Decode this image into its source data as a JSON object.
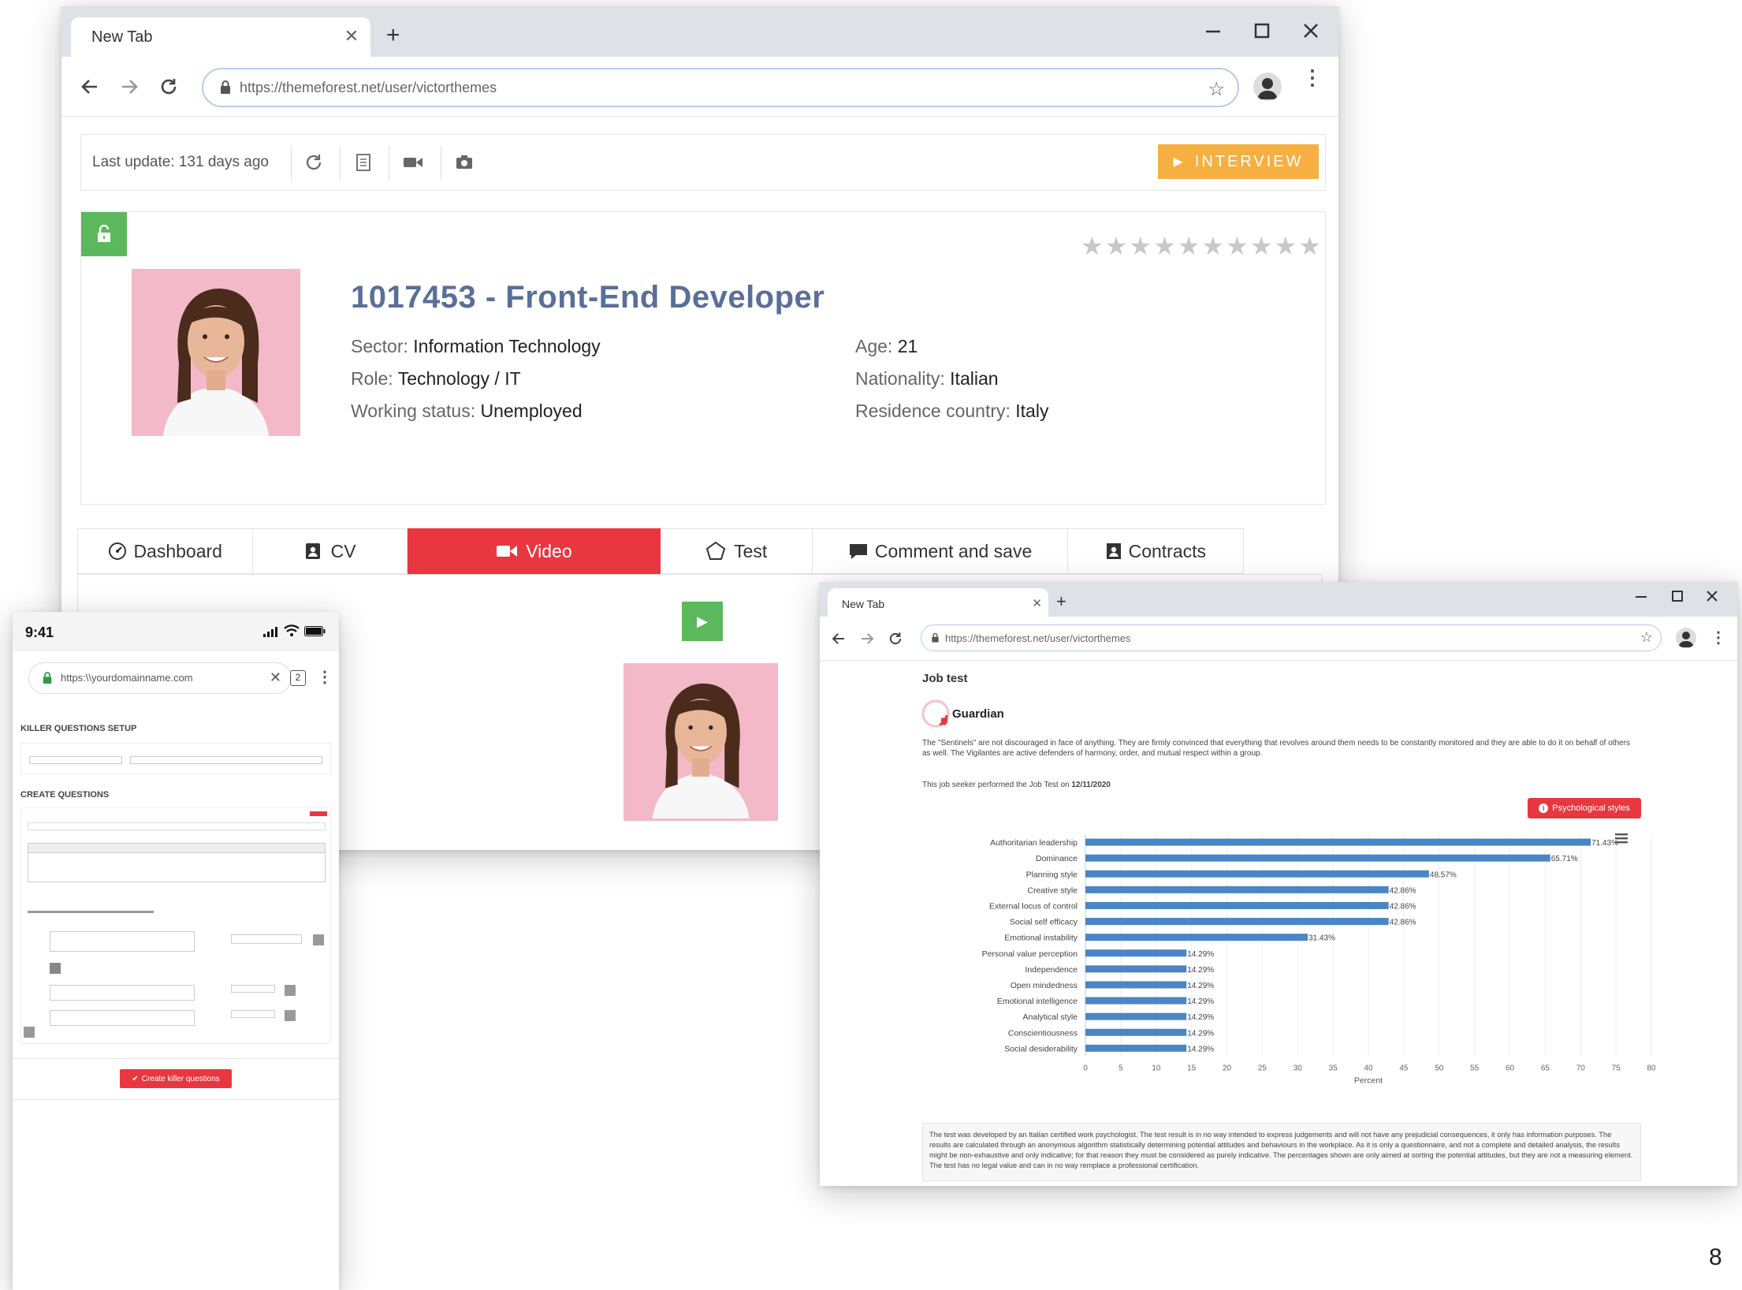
{
  "main_window": {
    "tab_title": "New Tab",
    "url": "https://themeforest.net/user/victorthemes"
  },
  "toolbar": {
    "last_update": "Last update: 131 days ago",
    "interview_label": "INTERVIEW"
  },
  "profile": {
    "title": "1017453 - Front-End Developer",
    "rating_stars": 10,
    "fields_left": [
      {
        "label": "Sector:",
        "value": "Information Technology"
      },
      {
        "label": "Role:",
        "value": "Technology / IT"
      },
      {
        "label": "Working status:",
        "value": "Unemployed"
      }
    ],
    "fields_right": [
      {
        "label": "Age:",
        "value": "21"
      },
      {
        "label": "Nationality:",
        "value": "Italian"
      },
      {
        "label": "Residence country:",
        "value": "Italy"
      }
    ]
  },
  "tabs": [
    {
      "label": "Dashboard",
      "icon": "dashboard-icon",
      "active": false
    },
    {
      "label": "CV",
      "icon": "cv-icon",
      "active": false
    },
    {
      "label": "Video",
      "icon": "video-icon",
      "active": true
    },
    {
      "label": "Test",
      "icon": "test-icon",
      "active": false
    },
    {
      "label": "Comment and save",
      "icon": "comment-icon",
      "active": false
    },
    {
      "label": "Contracts",
      "icon": "contracts-icon",
      "active": false
    }
  ],
  "mobile": {
    "time": "9:41",
    "url": "https:\\\\yourdomainname.com",
    "tab_count": "2",
    "section1": "KILLER QUESTIONS SETUP",
    "section2": "CREATE QUESTIONS",
    "create_button": "Create killer questions"
  },
  "test_window": {
    "tab_title": "New Tab",
    "url": "https://themeforest.net/user/victorthemes",
    "heading": "Job test",
    "type_name": "Guardian",
    "description": "The \"Sentinels\" are not discouraged in face of anything. They are firmly convinced that everything that revolves around them needs to be constantly monitored and they are able to do it on behalf of others as well. The Vigilantes are active defenders of harmony, order, and mutual respect within a group.",
    "performed_prefix": "This job seeker performed the Job Test on",
    "performed_date": "12/11/2020",
    "styles_button": "Psychological styles",
    "disclaimer": "The test was developed by an Italian certified work psychologist. The test result is in no way intended to express judgements and will not have any prejudicial consequences, it only has information purposes. The results are calculated through an anonymous algorithm statistically determining potential attitudes and behaviours in the workplace. As it is only a questionnaire, and not a complete and detailed analysis, the results might be non-exhaustive and only indicative; for that reason they must be considered as purely indicative. The percentages shown are only aimed at sorting the potential attitudes, but they are not a measuring element. The test has no legal value and can in no way remplace a professional certification."
  },
  "page_number": "8",
  "colors": {
    "accent_red": "#e8373f",
    "title_blue": "#5a6f98",
    "bar_blue": "#4a86c5",
    "green": "#5cb85c",
    "orange": "#f6b042"
  },
  "chart_data": {
    "type": "bar",
    "orientation": "horizontal",
    "categories": [
      "Authoritarian leadership",
      "Dominance",
      "Planning style",
      "Creative style",
      "External locus of control",
      "Social self efficacy",
      "Emotional instability",
      "Personal value perception",
      "Independence",
      "Open mindedness",
      "Emotional intelligence",
      "Analytical style",
      "Conscientiousness",
      "Social desiderability"
    ],
    "values": [
      71.43,
      65.71,
      48.57,
      42.86,
      42.86,
      42.86,
      31.43,
      14.29,
      14.29,
      14.29,
      14.29,
      14.29,
      14.29,
      14.29
    ],
    "value_labels": [
      "71.43%",
      "65.71%",
      "48.57%",
      "42.86%",
      "42.86%",
      "42.86%",
      "31.43%",
      "14.29%",
      "14.29%",
      "14.29%",
      "14.29%",
      "14.29%",
      "14.29%",
      "14.29%"
    ],
    "xlabel": "Percent",
    "xlim": [
      0,
      80
    ],
    "xticks": [
      0,
      5,
      10,
      15,
      20,
      25,
      30,
      35,
      40,
      45,
      50,
      55,
      60,
      65,
      70,
      75,
      80
    ],
    "grid": true
  }
}
